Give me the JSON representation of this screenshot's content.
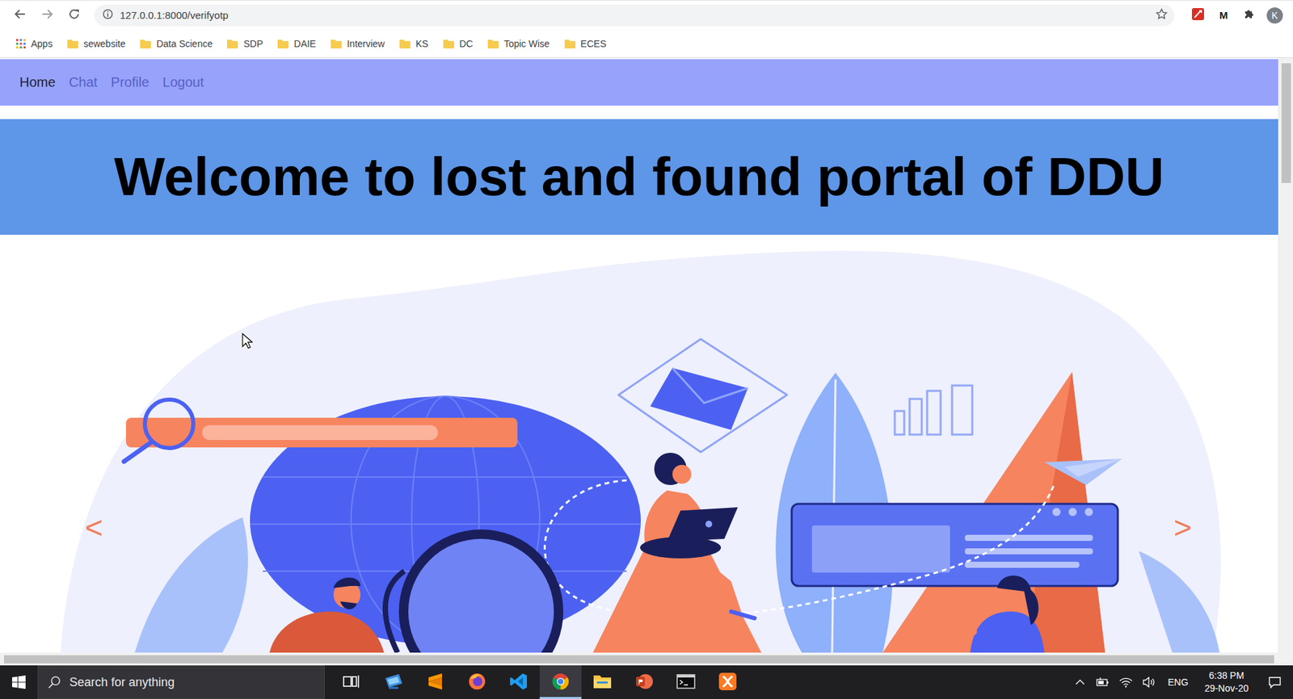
{
  "browser": {
    "url": "127.0.0.1:8000/verifyotp",
    "extension_letter": "M",
    "profile": "K"
  },
  "bookmarks": [
    {
      "label": "Apps",
      "kind": "apps"
    },
    {
      "label": "sewebsite",
      "kind": "folder"
    },
    {
      "label": "Data Science",
      "kind": "folder"
    },
    {
      "label": "SDP",
      "kind": "folder"
    },
    {
      "label": "DAIE",
      "kind": "folder"
    },
    {
      "label": "Interview",
      "kind": "folder"
    },
    {
      "label": "KS",
      "kind": "folder"
    },
    {
      "label": "DC",
      "kind": "folder"
    },
    {
      "label": "Topic Wise",
      "kind": "folder"
    },
    {
      "label": "ECES",
      "kind": "folder"
    }
  ],
  "nav": [
    {
      "label": "Home",
      "selected": true
    },
    {
      "label": "Chat",
      "selected": false
    },
    {
      "label": "Profile",
      "selected": false
    },
    {
      "label": "Logout",
      "selected": false
    }
  ],
  "banner": {
    "title": "Welcome to lost and found portal of DDU"
  },
  "carousel": {
    "prev": "<",
    "next": ">"
  },
  "taskbar": {
    "search": "Search for anything",
    "apps": [
      {
        "kind": "taskview",
        "selected": false
      },
      {
        "kind": "remote",
        "selected": false
      },
      {
        "kind": "sublime",
        "selected": false
      },
      {
        "kind": "firefox",
        "selected": false
      },
      {
        "kind": "vscode",
        "selected": false
      },
      {
        "kind": "chrome",
        "selected": true
      },
      {
        "kind": "explorer",
        "selected": false
      },
      {
        "kind": "powerpoint",
        "selected": false
      },
      {
        "kind": "terminal",
        "selected": false
      },
      {
        "kind": "xampp",
        "selected": false
      }
    ],
    "language": "ENG",
    "time": "6:38 PM",
    "date": "29-Nov-20"
  }
}
